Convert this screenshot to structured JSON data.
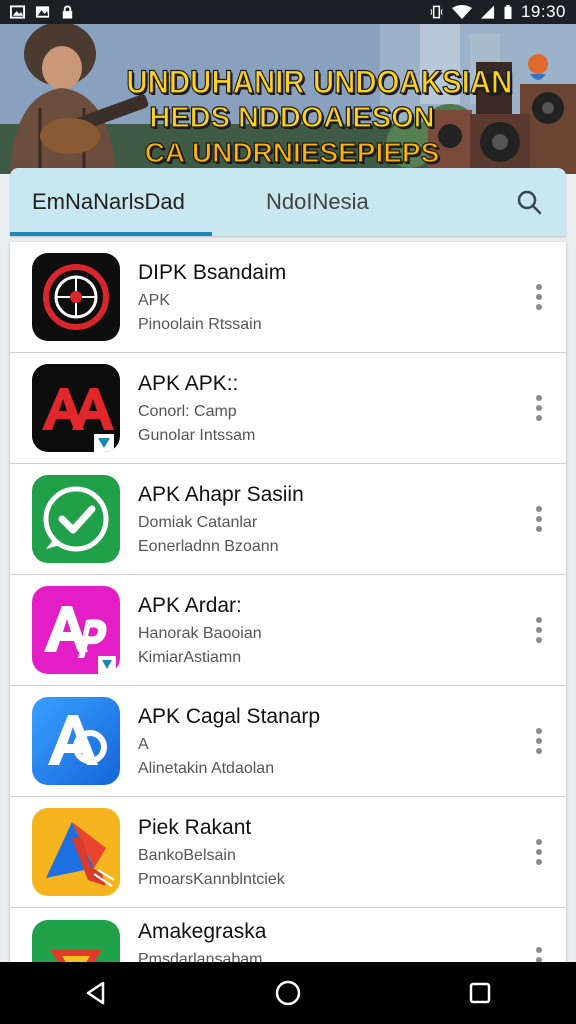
{
  "status_bar": {
    "time": "19:30",
    "left_icons": [
      "image-icon",
      "photo-icon",
      "lock-icon"
    ],
    "right_icons": [
      "vibrate-icon",
      "wifi-icon",
      "signal-icon",
      "battery-icon"
    ]
  },
  "banner": {
    "line1": "UNDUHANIR UNDOAKSIAN",
    "line2": "HEDS NDDOAIESON",
    "line3": "CA UNDRNIESEPIEPS"
  },
  "tabs": [
    {
      "label": "EmNaNarlsDad"
    },
    {
      "label": "NdoINesia"
    }
  ],
  "apps": [
    {
      "title": "DIPK Bsandaim",
      "sub1": "APK",
      "sub2": "Pinoolain Rtssain",
      "icon": "target-icon"
    },
    {
      "title": "APK APK::",
      "sub1": "Conorl: Camp",
      "sub2": "Gunolar Intssam",
      "icon": "aa-logo-icon"
    },
    {
      "title": "APK Ahapr Sasiin",
      "sub1": "Domiak Catanlar",
      "sub2": "Eonerladnn Bzoann",
      "icon": "check-badge-icon"
    },
    {
      "title": "APK Ardar:",
      "sub1": "Hanorak Baooian",
      "sub2": "KimiarAstiamn",
      "icon": "ap-logo-icon"
    },
    {
      "title": "APK Cagal Stanarp",
      "sub1": "A",
      "sub2": "Alinetakin Atdaolan",
      "icon": "a-logo-icon"
    },
    {
      "title": "Piek Rakant",
      "sub1": "BankoBelsain",
      "sub2": "PmoarsKannblntciek",
      "icon": "kite-logo-icon"
    },
    {
      "title": "Amakegraska",
      "sub1": "Pmsdarlansabam",
      "sub2": "",
      "icon": "green-app-icon"
    }
  ],
  "colors": {
    "tab_bar": "#c9e7ef",
    "tab_indicator": "#1e88b5",
    "banner_text": "#ffd21a"
  },
  "navbar": [
    "back-icon",
    "home-icon",
    "recents-icon"
  ]
}
